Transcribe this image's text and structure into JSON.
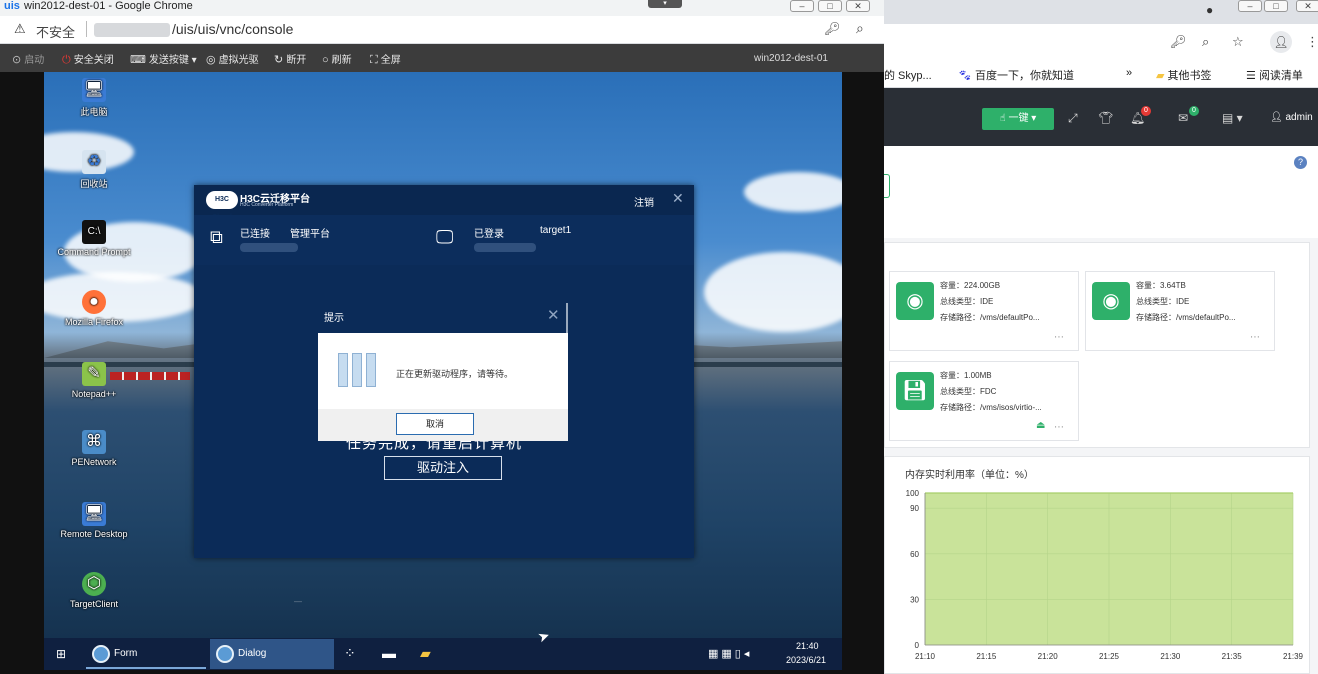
{
  "popup": {
    "title": "win2012-dest-01 - Google Chrome",
    "logo": "uis",
    "insecure": "不安全",
    "url": "/uis/uis/vnc/console",
    "toolbar": [
      {
        "icon": "power-icon",
        "label": "启动"
      },
      {
        "icon": "shutdown-icon",
        "label": "安全关闭"
      },
      {
        "icon": "keys-icon",
        "label": "发送按键"
      },
      {
        "icon": "cdrom-icon",
        "label": "虚拟光驱"
      },
      {
        "icon": "disconnect-icon",
        "label": "断开"
      },
      {
        "icon": "refresh-icon",
        "label": "刷新"
      },
      {
        "icon": "fullscreen-icon",
        "label": "全屏"
      }
    ],
    "vm_name": "win2012-dest-01"
  },
  "desktop": {
    "icons": [
      "此电脑",
      "回收站",
      "Command Prompt",
      "Mozilla Firefox",
      "Notepad++",
      "PENetwork",
      "Remote Desktop",
      "TargetClient"
    ],
    "dialog": {
      "logo": "H3C Cloud",
      "brand": "H3C云迁移平台",
      "brand_sub": "H3C Converter Platform",
      "logout": "注销",
      "connected": "已连接",
      "mgmt": "管理平台",
      "logged_in": "已登录",
      "target": "target1",
      "message_partial": "任务完成，请重启计算机",
      "inject_button": "驱动注入"
    },
    "hint": {
      "title": "提示",
      "message": "正在更新驱动程序，请等待。",
      "cancel": "取消"
    },
    "taskbar": {
      "tasks": [
        "Form",
        "Dialog"
      ],
      "time": "21:40",
      "date": "2023/6/21"
    }
  },
  "main": {
    "bookmarks": [
      "的 Skyp...",
      "百度一下，你就知道",
      "»",
      "其他书签",
      "阅读清单"
    ],
    "header": {
      "onekey": "一键",
      "alert_badge": "0",
      "msg_badge": "0",
      "user": "admin"
    },
    "storage": [
      {
        "lines": [
          "容量：224.00GB",
          "总线类型：IDE",
          "存储路径：/vms/defaultPo..."
        ]
      },
      {
        "lines": [
          "容量：3.64TB",
          "总线类型：IDE",
          "存储路径：/vms/defaultPo..."
        ]
      },
      {
        "lines": [
          "容量：1.00MB",
          "总线类型：FDC",
          "存储路径：/vms/isos/virtio-..."
        ]
      }
    ],
    "memory_title": "内存实时利用率（单位：%）"
  },
  "chart_data": {
    "type": "area",
    "title": "内存实时利用率（单位：%）",
    "xlabel": "",
    "ylabel": "",
    "x": [
      "21:10",
      "21:15",
      "21:20",
      "21:25",
      "21:30",
      "21:35",
      "21:39"
    ],
    "yticks": [
      0,
      30,
      60,
      90,
      100
    ],
    "ylim": [
      0,
      100
    ],
    "series": [
      {
        "values": [
          100,
          100,
          100,
          100,
          100,
          100,
          100
        ]
      }
    ],
    "grid": true,
    "fill_color": "#c9e39a",
    "line_color": "#a7cf6b"
  }
}
